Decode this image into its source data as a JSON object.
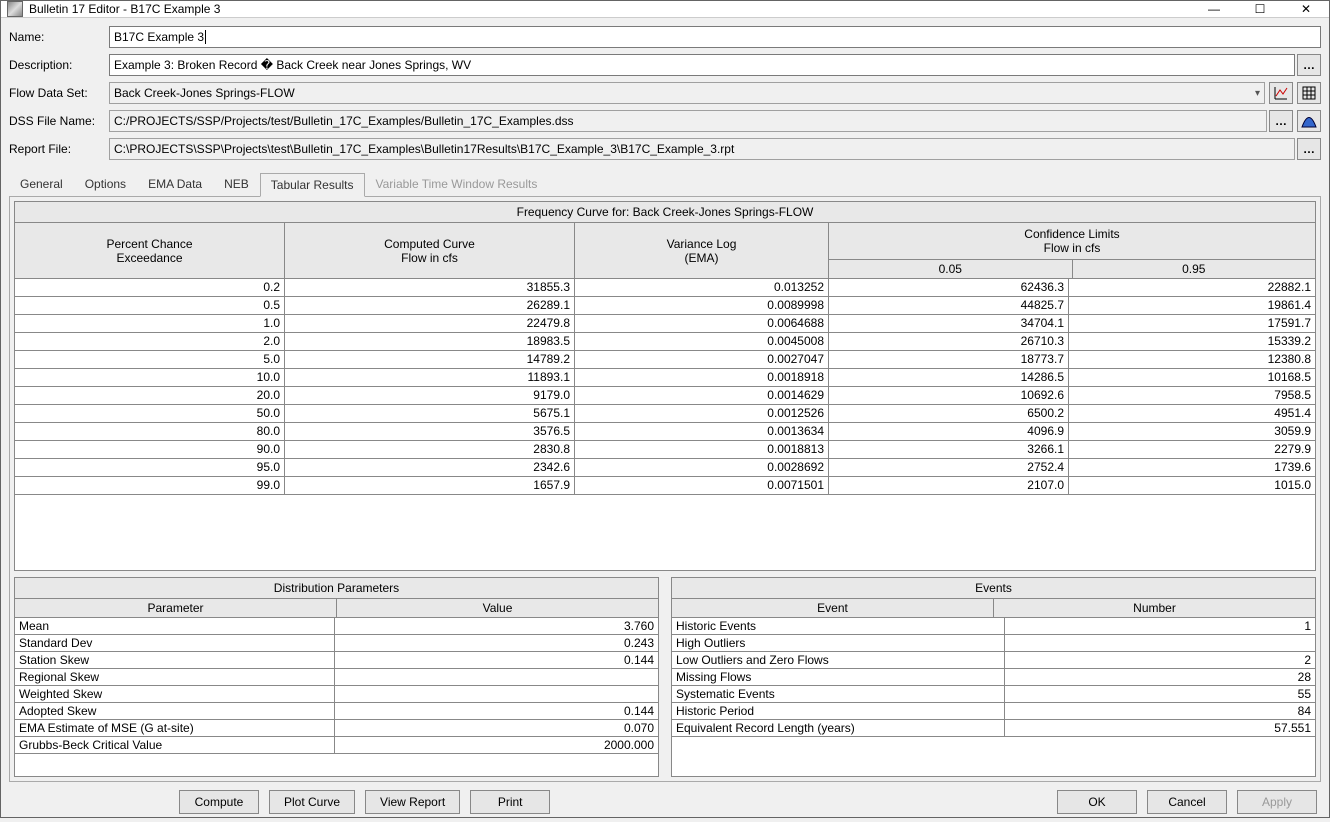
{
  "window": {
    "title": "Bulletin 17 Editor - B17C Example 3"
  },
  "form": {
    "name_label": "Name:",
    "name_value": "B17C Example 3",
    "desc_label": "Description:",
    "desc_value": "Example 3: Broken Record � Back Creek near Jones Springs, WV",
    "flowset_label": "Flow Data Set:",
    "flowset_value": "Back Creek-Jones Springs-FLOW",
    "dss_label": "DSS File Name:",
    "dss_value": "C:/PROJECTS/SSP/Projects/test/Bulletin_17C_Examples/Bulletin_17C_Examples.dss",
    "report_label": "Report File:",
    "report_value": "C:\\PROJECTS\\SSP\\Projects\\test\\Bulletin_17C_Examples\\Bulletin17Results\\B17C_Example_3\\B17C_Example_3.rpt"
  },
  "tabs": [
    "General",
    "Options",
    "EMA Data",
    "NEB",
    "Tabular Results",
    "Variable Time Window Results"
  ],
  "active_tab": "Tabular Results",
  "freq": {
    "title": "Frequency Curve for: Back Creek-Jones Springs-FLOW",
    "col1a": "Percent Chance",
    "col1b": "Exceedance",
    "col2a": "Computed Curve",
    "col2b": "Flow in cfs",
    "col3a": "Variance Log",
    "col3b": "(EMA)",
    "col4a": "Confidence Limits",
    "col4b": "Flow in cfs",
    "sub1": "0.05",
    "sub2": "0.95",
    "rows": [
      {
        "p": "0.2",
        "c": "31855.3",
        "v": "0.013252",
        "lo": "62436.3",
        "hi": "22882.1"
      },
      {
        "p": "0.5",
        "c": "26289.1",
        "v": "0.0089998",
        "lo": "44825.7",
        "hi": "19861.4"
      },
      {
        "p": "1.0",
        "c": "22479.8",
        "v": "0.0064688",
        "lo": "34704.1",
        "hi": "17591.7"
      },
      {
        "p": "2.0",
        "c": "18983.5",
        "v": "0.0045008",
        "lo": "26710.3",
        "hi": "15339.2"
      },
      {
        "p": "5.0",
        "c": "14789.2",
        "v": "0.0027047",
        "lo": "18773.7",
        "hi": "12380.8"
      },
      {
        "p": "10.0",
        "c": "11893.1",
        "v": "0.0018918",
        "lo": "14286.5",
        "hi": "10168.5"
      },
      {
        "p": "20.0",
        "c": "9179.0",
        "v": "0.0014629",
        "lo": "10692.6",
        "hi": "7958.5"
      },
      {
        "p": "50.0",
        "c": "5675.1",
        "v": "0.0012526",
        "lo": "6500.2",
        "hi": "4951.4"
      },
      {
        "p": "80.0",
        "c": "3576.5",
        "v": "0.0013634",
        "lo": "4096.9",
        "hi": "3059.9"
      },
      {
        "p": "90.0",
        "c": "2830.8",
        "v": "0.0018813",
        "lo": "3266.1",
        "hi": "2279.9"
      },
      {
        "p": "95.0",
        "c": "2342.6",
        "v": "0.0028692",
        "lo": "2752.4",
        "hi": "1739.6"
      },
      {
        "p": "99.0",
        "c": "1657.9",
        "v": "0.0071501",
        "lo": "2107.0",
        "hi": "1015.0"
      }
    ]
  },
  "params": {
    "title": "Distribution Parameters",
    "h1": "Parameter",
    "h2": "Value",
    "rows": [
      {
        "k": "Mean",
        "v": "3.760"
      },
      {
        "k": "Standard Dev",
        "v": "0.243"
      },
      {
        "k": "Station Skew",
        "v": "0.144"
      },
      {
        "k": "Regional Skew",
        "v": ""
      },
      {
        "k": "Weighted Skew",
        "v": ""
      },
      {
        "k": "Adopted Skew",
        "v": "0.144"
      },
      {
        "k": "EMA Estimate of MSE (G at-site)",
        "v": "0.070"
      },
      {
        "k": "Grubbs-Beck Critical Value",
        "v": "2000.000"
      }
    ]
  },
  "events": {
    "title": "Events",
    "h1": "Event",
    "h2": "Number",
    "rows": [
      {
        "k": "Historic Events",
        "v": "1"
      },
      {
        "k": "High Outliers",
        "v": ""
      },
      {
        "k": "Low Outliers and Zero Flows",
        "v": "2"
      },
      {
        "k": "Missing Flows",
        "v": "28"
      },
      {
        "k": "Systematic Events",
        "v": "55"
      },
      {
        "k": "Historic Period",
        "v": "84"
      },
      {
        "k": "Equivalent Record Length (years)",
        "v": "57.551"
      }
    ]
  },
  "buttons": {
    "compute": "Compute",
    "plot": "Plot Curve",
    "view": "View Report",
    "print": "Print",
    "ok": "OK",
    "cancel": "Cancel",
    "apply": "Apply"
  }
}
